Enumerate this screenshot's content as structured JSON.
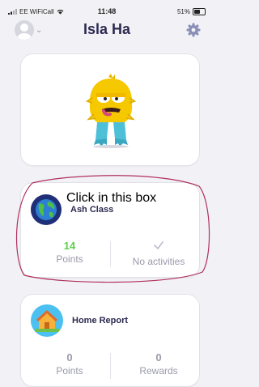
{
  "status": {
    "carrier": "EE WiFiCall",
    "time": "11:48",
    "battery": "51%"
  },
  "header": {
    "title": "Isla Ha"
  },
  "class_card": {
    "overlay_text": "Click in this box",
    "class_name": "Ash Class",
    "points_value": "14",
    "points_label": "Points",
    "activities_label": "No activities"
  },
  "report_card": {
    "title": "Home Report",
    "points_value": "0",
    "points_label": "Points",
    "rewards_value": "0",
    "rewards_label": "Rewards"
  },
  "colors": {
    "accent": "#2c2a50",
    "points_green": "#5ed04a",
    "muted": "#9a9aab",
    "annotation": "#b0305a"
  },
  "icons": [
    "signal-icon",
    "wifi-icon",
    "battery-icon",
    "avatar-icon",
    "chevron-down-icon",
    "gear-icon",
    "monster-avatar",
    "globe-icon",
    "check-icon",
    "house-icon"
  ]
}
